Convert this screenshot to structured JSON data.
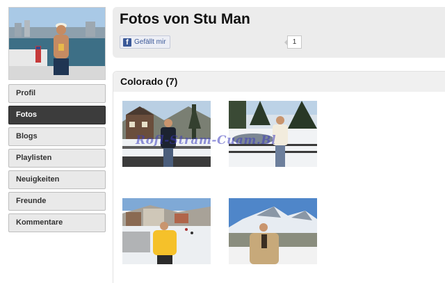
{
  "profile": {
    "name": "Stu Man",
    "page_title": "Fotos von Stu Man"
  },
  "sidebar": {
    "items": [
      {
        "label": "Profil",
        "active": false
      },
      {
        "label": "Fotos",
        "active": true
      },
      {
        "label": "Blogs",
        "active": false
      },
      {
        "label": "Playlisten",
        "active": false
      },
      {
        "label": "Neuigkeiten",
        "active": false
      },
      {
        "label": "Freunde",
        "active": false
      },
      {
        "label": "Kommentare",
        "active": false
      }
    ]
  },
  "like": {
    "label": "Gefällt mir",
    "count": "1"
  },
  "album": {
    "title": "Colorado (7)",
    "photos": [
      {
        "subject": "man-in-dark-jacket-by-snowy-lodge"
      },
      {
        "subject": "man-in-white-shirt-by-snowy-creek"
      },
      {
        "subject": "skier-in-yellow-jacket-on-slope"
      },
      {
        "subject": "man-in-tan-jacket-mountain-view"
      }
    ]
  },
  "watermark": "Rofl-Stram-Cuam.Bl",
  "colors": {
    "nav_active_bg": "#3c3c3c",
    "nav_bg": "#e9e9e9",
    "card_bg": "#ececec",
    "facebook_blue": "#3b5998"
  }
}
